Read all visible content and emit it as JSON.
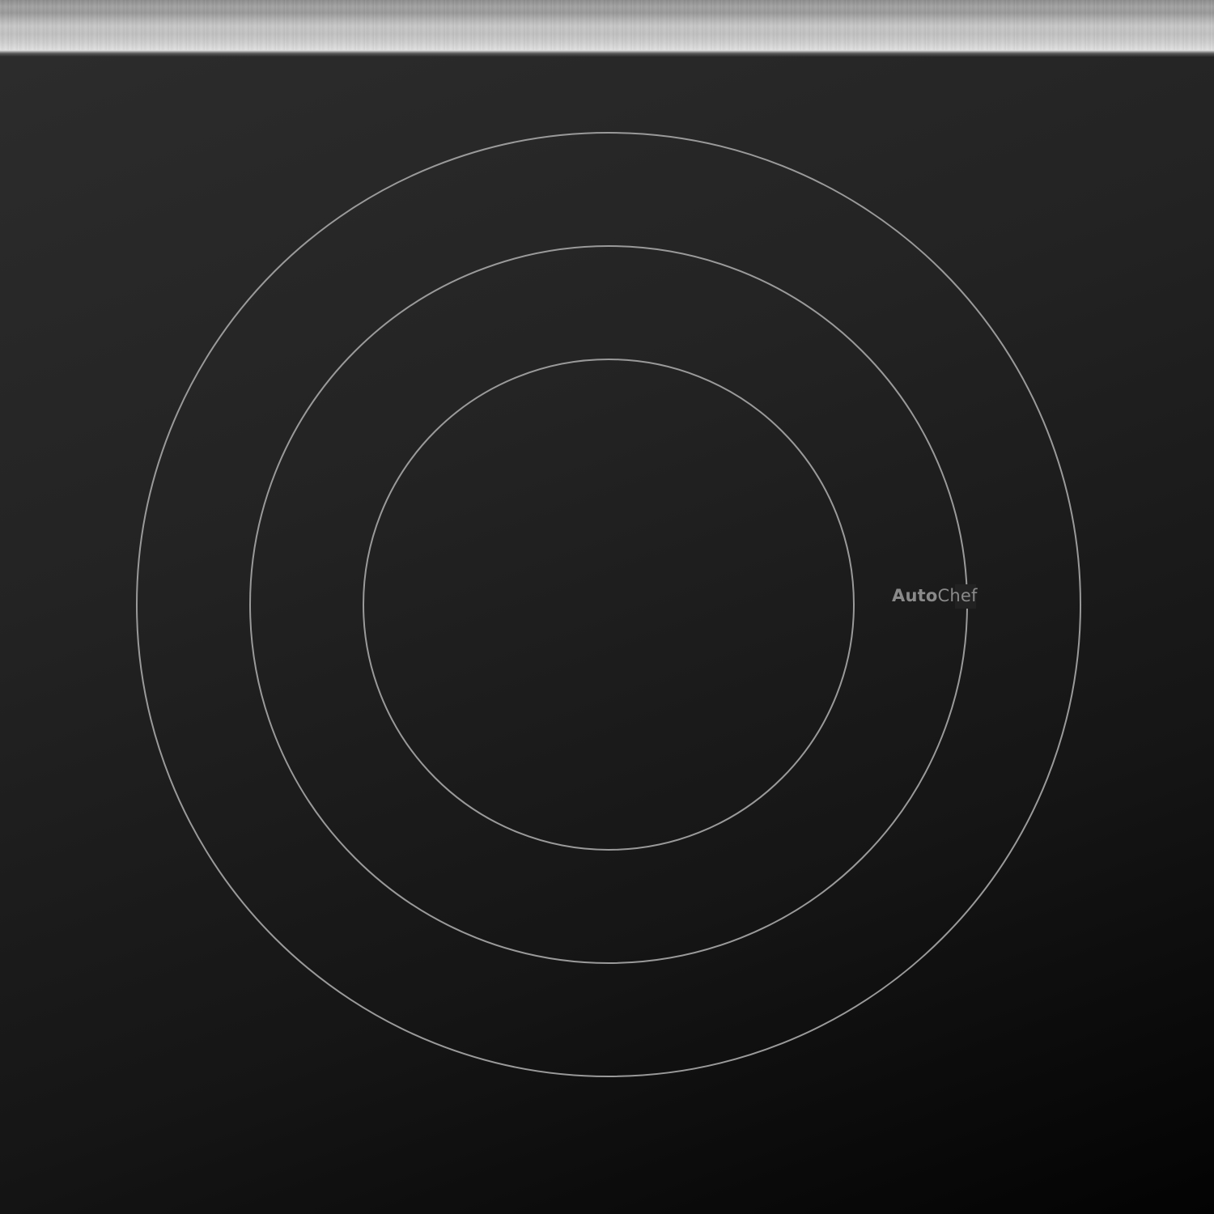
{
  "cooktop": {
    "brand": {
      "part1": "Auto",
      "part2": "Chef"
    },
    "ring_color": "#9a9a9a",
    "glass_color": "#1c1c1c",
    "trim_color": "#c4c4c4"
  }
}
